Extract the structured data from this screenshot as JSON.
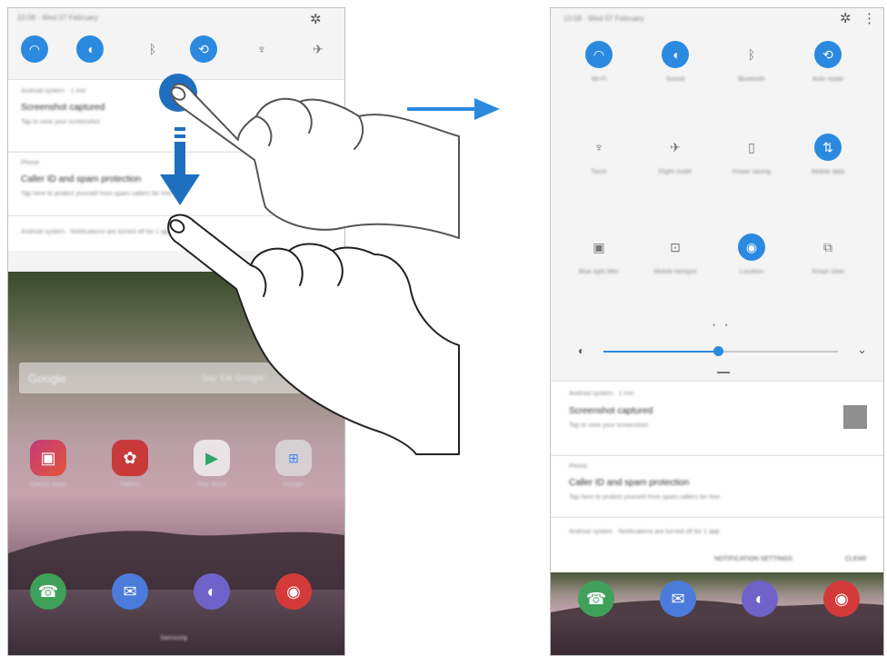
{
  "left": {
    "status_text": "10:08 · Wed 07 February",
    "notifications": [
      {
        "app": "Android system · 1 min",
        "title": "Screenshot captured",
        "body": "Tap to view your screenshot"
      },
      {
        "app": "Phone",
        "title": "Caller ID and spam protection",
        "body": "Tap here to protect yourself from spam callers for free"
      },
      {
        "app": "Android system · Notifications are turned off for 1 app"
      }
    ],
    "search_label": "Google",
    "search_hint": "Say 'Ok Google'",
    "apps": [
      "Galaxy Apps",
      "Gallery",
      "Play Store",
      "Google"
    ],
    "dock_label": "Samsung"
  },
  "right": {
    "status_text": "10:08 · Wed 07 February",
    "quick_settings": [
      {
        "label": "Wi-Fi",
        "icon": "wifi-icon",
        "on": true
      },
      {
        "label": "Sound",
        "icon": "sound-icon",
        "on": true
      },
      {
        "label": "Bluetooth",
        "icon": "bluetooth-icon",
        "on": false
      },
      {
        "label": "Auto rotate",
        "icon": "rotate-icon",
        "on": true
      },
      {
        "label": "Torch",
        "icon": "torch-icon",
        "on": false
      },
      {
        "label": "Flight mode",
        "icon": "airplane-icon",
        "on": false
      },
      {
        "label": "Power saving",
        "icon": "battery-icon",
        "on": false
      },
      {
        "label": "Mobile data",
        "icon": "mobile-data-icon",
        "on": true
      },
      {
        "label": "Blue light filter",
        "icon": "blue-light-icon",
        "on": false
      },
      {
        "label": "Mobile Hotspot",
        "icon": "hotspot-icon",
        "on": false
      },
      {
        "label": "Location",
        "icon": "location-icon",
        "on": true
      },
      {
        "label": "Smart View",
        "icon": "smart-view-icon",
        "on": false
      }
    ],
    "brightness": 0.49,
    "notifications": [
      {
        "app": "Android system · 1 min",
        "title": "Screenshot captured",
        "body": "Tap to view your screenshot"
      },
      {
        "app": "Phone",
        "title": "Caller ID and spam protection",
        "body": "Tap here to protect yourself from spam callers for free"
      },
      {
        "app": "Android system · Notifications are turned off for 1 app"
      }
    ],
    "actions": {
      "settings": "NOTIFICATION SETTINGS",
      "clear": "CLEAR"
    }
  },
  "colors": {
    "accent": "#2b8ae0",
    "panel": "#f4f4f4"
  }
}
